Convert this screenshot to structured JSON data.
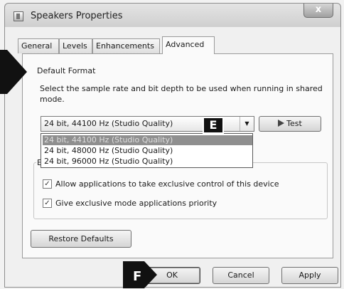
{
  "window": {
    "title": "Speakers Properties",
    "close_symbol": "x"
  },
  "tabs": [
    {
      "label": "General"
    },
    {
      "label": "Levels"
    },
    {
      "label": "Enhancements"
    },
    {
      "label": "Advanced",
      "active": true
    }
  ],
  "default_format": {
    "group_label": "Default Format",
    "description": "Select the sample rate and bit depth to be used when running in shared mode.",
    "selected_value": "24 bit, 44100 Hz (Studio Quality)",
    "options": [
      "24 bit, 44100 Hz (Studio Quality)",
      "24 bit, 48000 Hz (Studio Quality)",
      "24 bit, 96000 Hz (Studio Quality)"
    ],
    "test_label": "Test"
  },
  "exclusive_mode": {
    "group_label_fragment": "E",
    "options": [
      {
        "label": "Allow applications to take exclusive control of this device",
        "checked": true
      },
      {
        "label": "Give exclusive mode applications priority",
        "checked": true
      }
    ]
  },
  "buttons": {
    "restore_defaults": "Restore Defaults",
    "ok": "OK",
    "cancel": "Cancel",
    "apply": "Apply"
  },
  "callouts": {
    "e": "E",
    "f": "F"
  }
}
